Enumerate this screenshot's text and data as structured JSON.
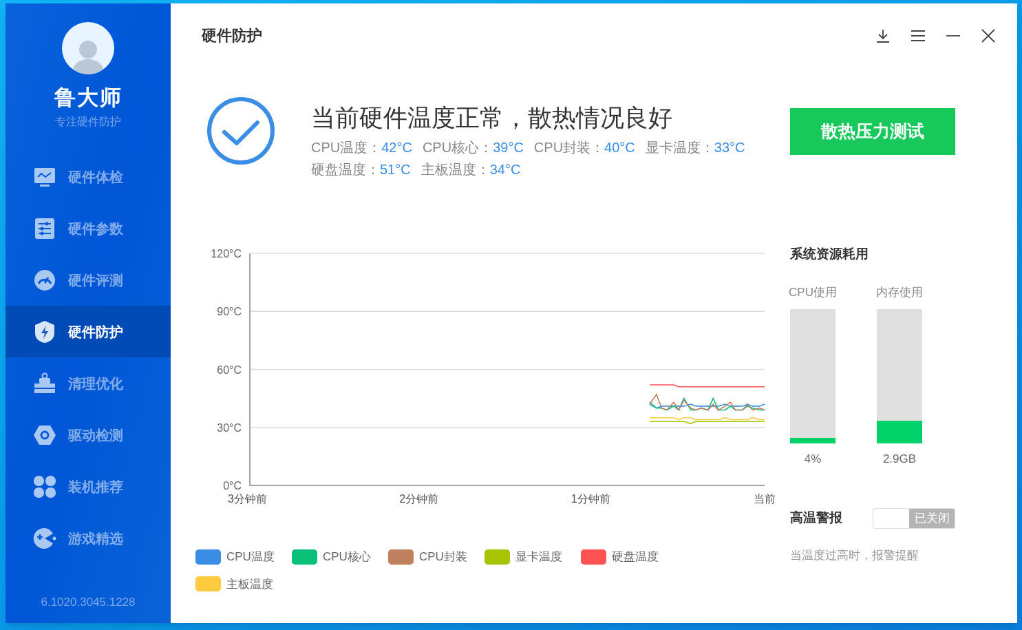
{
  "window": {
    "title": "硬件防护"
  },
  "sidebar": {
    "app_name": "鲁大师",
    "tagline": "专注硬件防护",
    "items": [
      {
        "label": "硬件体检",
        "selected": false
      },
      {
        "label": "硬件参数",
        "selected": false
      },
      {
        "label": "硬件评测",
        "selected": false
      },
      {
        "label": "硬件防护",
        "selected": true
      },
      {
        "label": "清理优化",
        "selected": false
      },
      {
        "label": "驱动检测",
        "selected": false
      },
      {
        "label": "装机推荐",
        "selected": false
      },
      {
        "label": "游戏精选",
        "selected": false
      }
    ],
    "version": "6.1020.3045.1228"
  },
  "status": {
    "headline": "当前硬件温度正常，散热情况良好",
    "readings": [
      {
        "label": "CPU温度：",
        "value": "42°C"
      },
      {
        "label": "CPU核心：",
        "value": "39°C"
      },
      {
        "label": "CPU封装：",
        "value": "40°C"
      },
      {
        "label": "显卡温度：",
        "value": "33°C"
      },
      {
        "label": "硬盘温度：",
        "value": "51°C"
      },
      {
        "label": "主板温度：",
        "value": "34°C"
      }
    ]
  },
  "stress_test_button": "散热压力测试",
  "chart_data": {
    "type": "line",
    "grid": true,
    "x": [
      0.67,
      0.63,
      0.6,
      0.57,
      0.53,
      0.5,
      0.47,
      0.43,
      0.4,
      0.37,
      0.33,
      0.3,
      0.27,
      0.23,
      0.2,
      0.17,
      0.13,
      0.1,
      0.07,
      0.03,
      0
    ],
    "xlim": [
      3,
      0
    ],
    "ylim": [
      0,
      120
    ],
    "xticks": [
      {
        "value": 3,
        "label": "3分钟前"
      },
      {
        "value": 2,
        "label": "2分钟前"
      },
      {
        "value": 1,
        "label": "1分钟前"
      },
      {
        "value": 0,
        "label": "当前"
      }
    ],
    "yticks": [
      {
        "value": 0,
        "label": "0°C"
      },
      {
        "value": 30,
        "label": "30°C"
      },
      {
        "value": 60,
        "label": "60°C"
      },
      {
        "value": 90,
        "label": "90°C"
      },
      {
        "value": 120,
        "label": "120°C"
      }
    ],
    "series": [
      {
        "name": "CPU温度",
        "color": "#3a8ee6",
        "values": [
          42,
          40,
          41,
          41,
          41,
          41,
          41,
          42,
          41,
          41,
          41,
          41,
          41,
          42,
          41,
          41,
          41,
          42,
          41,
          41,
          42
        ]
      },
      {
        "name": "CPU核心",
        "color": "#0abf7a",
        "values": [
          43,
          40,
          40,
          39,
          41,
          39,
          45,
          39,
          39,
          40,
          39,
          45,
          39,
          39,
          41,
          39,
          39,
          41,
          40,
          39,
          39
        ]
      },
      {
        "name": "CPU封装",
        "color": "#c08060",
        "values": [
          42,
          47,
          40,
          39,
          43,
          39,
          44,
          40,
          39,
          40,
          39,
          42,
          39,
          41,
          43,
          39,
          39,
          42,
          39,
          40,
          39
        ]
      },
      {
        "name": "显卡温度",
        "color": "#a8c400",
        "values": [
          33,
          33,
          33,
          33,
          33,
          33,
          33,
          32,
          33,
          33,
          33,
          33,
          33,
          33,
          33,
          33,
          33,
          33,
          33,
          33,
          33
        ]
      },
      {
        "name": "硬盘温度",
        "color": "#ff5252",
        "values": [
          52,
          52,
          52,
          52,
          52,
          51,
          51,
          51,
          51,
          51,
          51,
          51,
          51,
          51,
          51,
          51,
          51,
          51,
          51,
          51,
          51
        ]
      },
      {
        "name": "主板温度",
        "color": "#fccb40",
        "values": [
          35,
          35,
          35,
          35,
          35,
          34,
          35,
          35,
          34,
          34,
          34,
          34,
          34,
          35,
          34,
          34,
          34,
          34,
          35,
          34,
          34
        ]
      }
    ]
  },
  "resources": {
    "title": "系统资源耗用",
    "meters": [
      {
        "label": "CPU使用",
        "level": 0.04,
        "reading": "4%"
      },
      {
        "label": "内存使用",
        "level": 0.17,
        "reading": "2.9GB"
      }
    ]
  },
  "alert": {
    "title": "高温警报",
    "on": false,
    "toggle_label": "已关闭",
    "note": "当温度过高时，报警提醒"
  }
}
